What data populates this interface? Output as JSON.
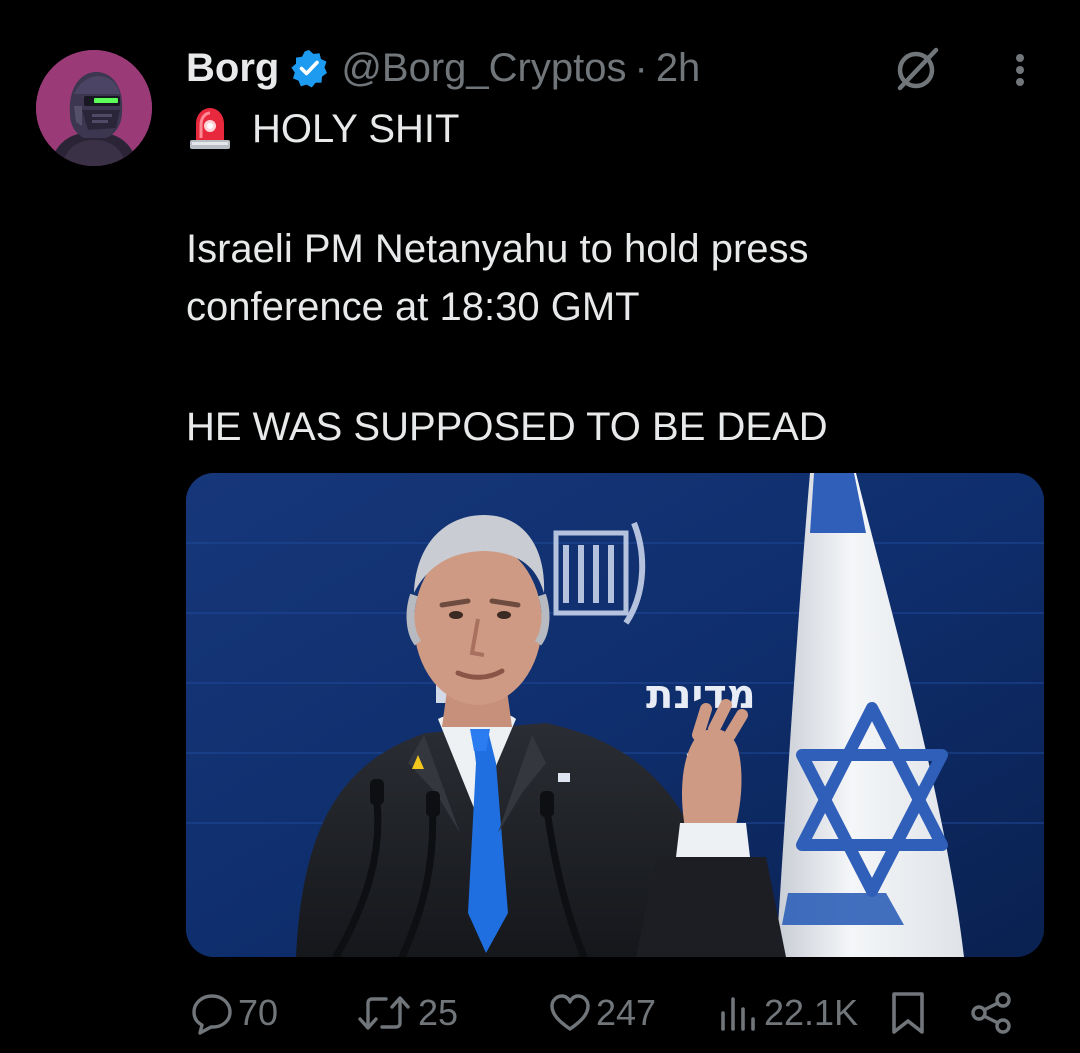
{
  "tweet": {
    "author": {
      "display_name": "Borg",
      "handle": "@Borg_Cryptos",
      "separator": "·",
      "time": "2h",
      "verified": true,
      "verified_color": "#1d9bf0"
    },
    "body": {
      "emoji": "rotating-light-siren",
      "line1": "HOLY SHIT",
      "line2": "Israeli PM Netanyahu to hold press",
      "line3": "conference at 18:30 GMT",
      "line4": "HE WAS SUPPOSED TO BE DEAD"
    },
    "media": {
      "kind": "photo",
      "description_icon": "photo-of-speaker-at-podium",
      "backdrop_text": "מדינת"
    },
    "actions": {
      "replies": "70",
      "reposts": "25",
      "likes": "247",
      "views": "22.1K"
    },
    "icons": {
      "grok": "grok-icon",
      "more": "more-icon",
      "reply": "reply-icon",
      "repost": "repost-icon",
      "like": "heart-icon",
      "views": "views-icon",
      "bookmark": "bookmark-icon",
      "share": "share-icon"
    },
    "colors": {
      "background": "#000000",
      "text_primary": "#e7e9ea",
      "text_secondary": "#71767b",
      "accent_blue": "#1d9bf0"
    }
  }
}
